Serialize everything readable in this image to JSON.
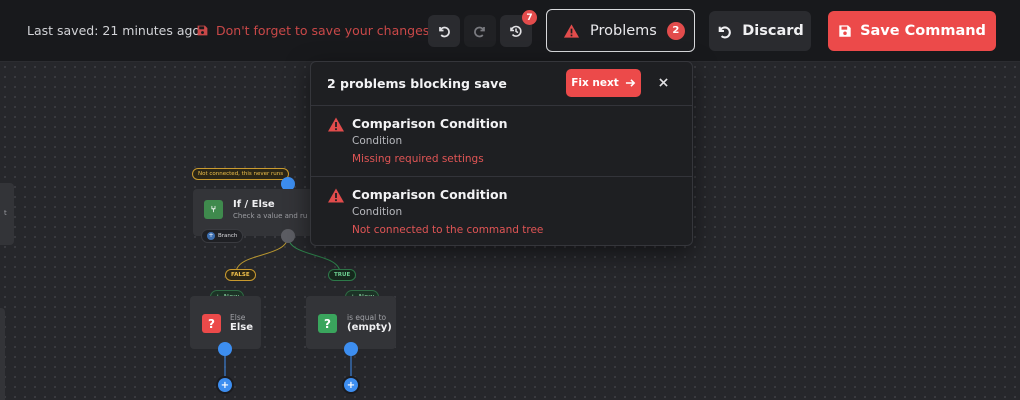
{
  "header": {
    "last_saved": "Last saved: 21 minutes ago",
    "save_reminder": "Don't forget to save your changes!",
    "history_count": "7",
    "problems_label": "Problems",
    "problems_count": "2",
    "discard_label": "Discard",
    "save_label": "Save Command"
  },
  "problems_popover": {
    "title": "2 problems blocking save",
    "fix_next_label": "Fix next",
    "items": [
      {
        "title": "Comparison Condition",
        "subtitle": "Condition",
        "error": "Missing required settings"
      },
      {
        "title": "Comparison Condition",
        "subtitle": "Condition",
        "error": "Not connected to the command tree"
      }
    ]
  },
  "canvas": {
    "if_else": {
      "warning": "Not connected, this never runs",
      "title": "If / Else",
      "description": "Check a value and ru",
      "type_tag": "Branch"
    },
    "edge_false_label": "FALSE",
    "edge_true_label": "TRUE",
    "else_node": {
      "new_label": "New",
      "small": "Else",
      "title": "Else"
    },
    "condition_node": {
      "new_label": "New",
      "small": "is equal to",
      "title": "(empty)"
    },
    "left_partial_text": "t"
  },
  "colors": {
    "accent_red": "#ec4a4a",
    "port_blue": "#3d8ef0",
    "warning_orange": "#e8a32a",
    "success_green": "#3aa55d"
  }
}
